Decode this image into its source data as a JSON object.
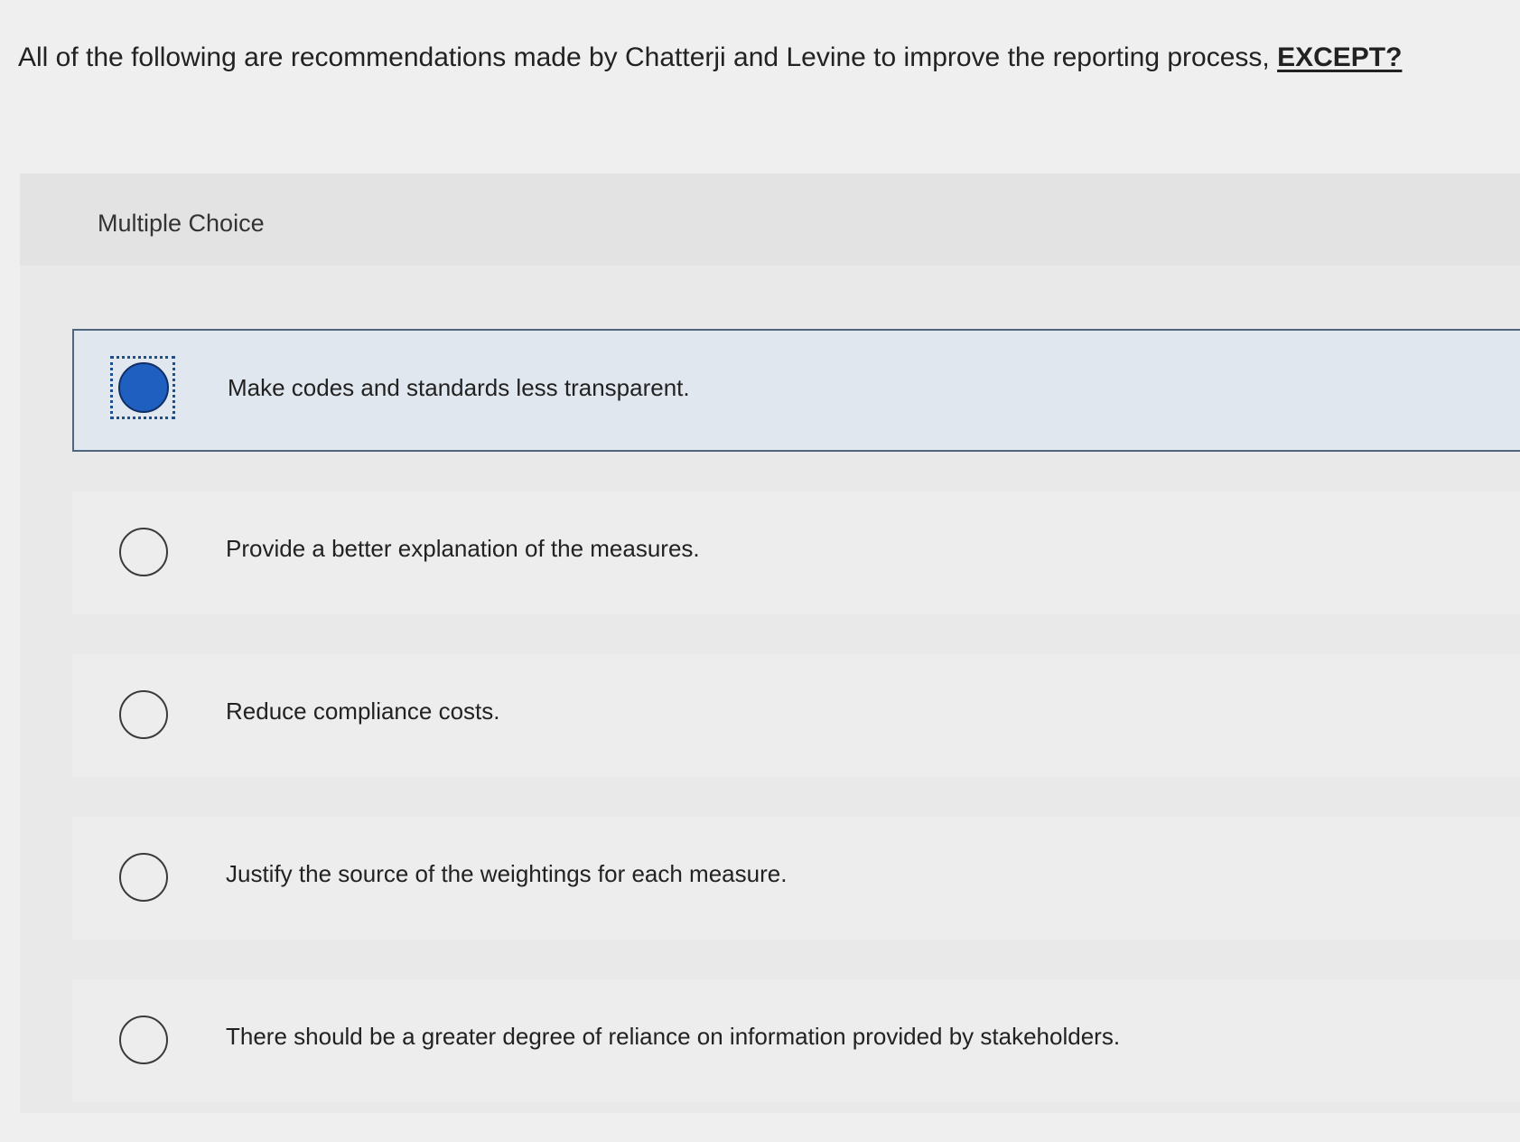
{
  "question": {
    "text": "All of the following are recommendations made by Chatterji and Levine to improve the reporting process,",
    "emphasis": "EXCEPT?"
  },
  "panel": {
    "title": "Multiple Choice"
  },
  "options": [
    {
      "label": "Make codes and standards less transparent.",
      "selected": true
    },
    {
      "label": "Provide a better explanation of the measures.",
      "selected": false
    },
    {
      "label": "Reduce compliance costs.",
      "selected": false
    },
    {
      "label": "Justify the source of the weightings for each measure.",
      "selected": false
    },
    {
      "label": "There should be a greater degree of reliance on information provided by stakeholders.",
      "selected": false
    }
  ],
  "colors": {
    "selected_fill": "#1f5fbf",
    "selected_border": "#50657e"
  }
}
